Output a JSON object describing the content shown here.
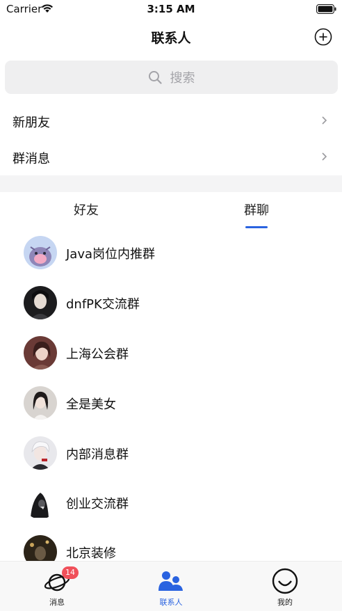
{
  "status_bar": {
    "carrier": "Carrier",
    "time": "3:15 AM",
    "wifi_icon": "wifi-icon",
    "battery_icon": "battery-icon"
  },
  "nav": {
    "title": "联系人",
    "add_icon": "plus-circle-icon"
  },
  "search": {
    "placeholder": "搜索",
    "icon": "search-icon"
  },
  "menu": [
    {
      "label": "新朋友"
    },
    {
      "label": "群消息"
    }
  ],
  "tabs": [
    {
      "label": "好友",
      "active": false
    },
    {
      "label": "群聊",
      "active": true
    }
  ],
  "groups": [
    {
      "name": "Java岗位内推群"
    },
    {
      "name": "dnfPK交流群"
    },
    {
      "name": "上海公会群"
    },
    {
      "name": "全是美女"
    },
    {
      "name": "内部消息群"
    },
    {
      "name": "创业交流群"
    },
    {
      "name": "北京装修"
    }
  ],
  "tab_bar": {
    "items": [
      {
        "label": "消息",
        "icon": "planet-icon",
        "badge": "14",
        "active": false
      },
      {
        "label": "联系人",
        "icon": "contacts-icon",
        "active": true
      },
      {
        "label": "我的",
        "icon": "smile-icon",
        "active": false
      }
    ]
  },
  "colors": {
    "accent": "#2a63e0",
    "badge": "#f0505a",
    "search_bg": "#efeff0",
    "section_gap": "#f4f4f5"
  }
}
